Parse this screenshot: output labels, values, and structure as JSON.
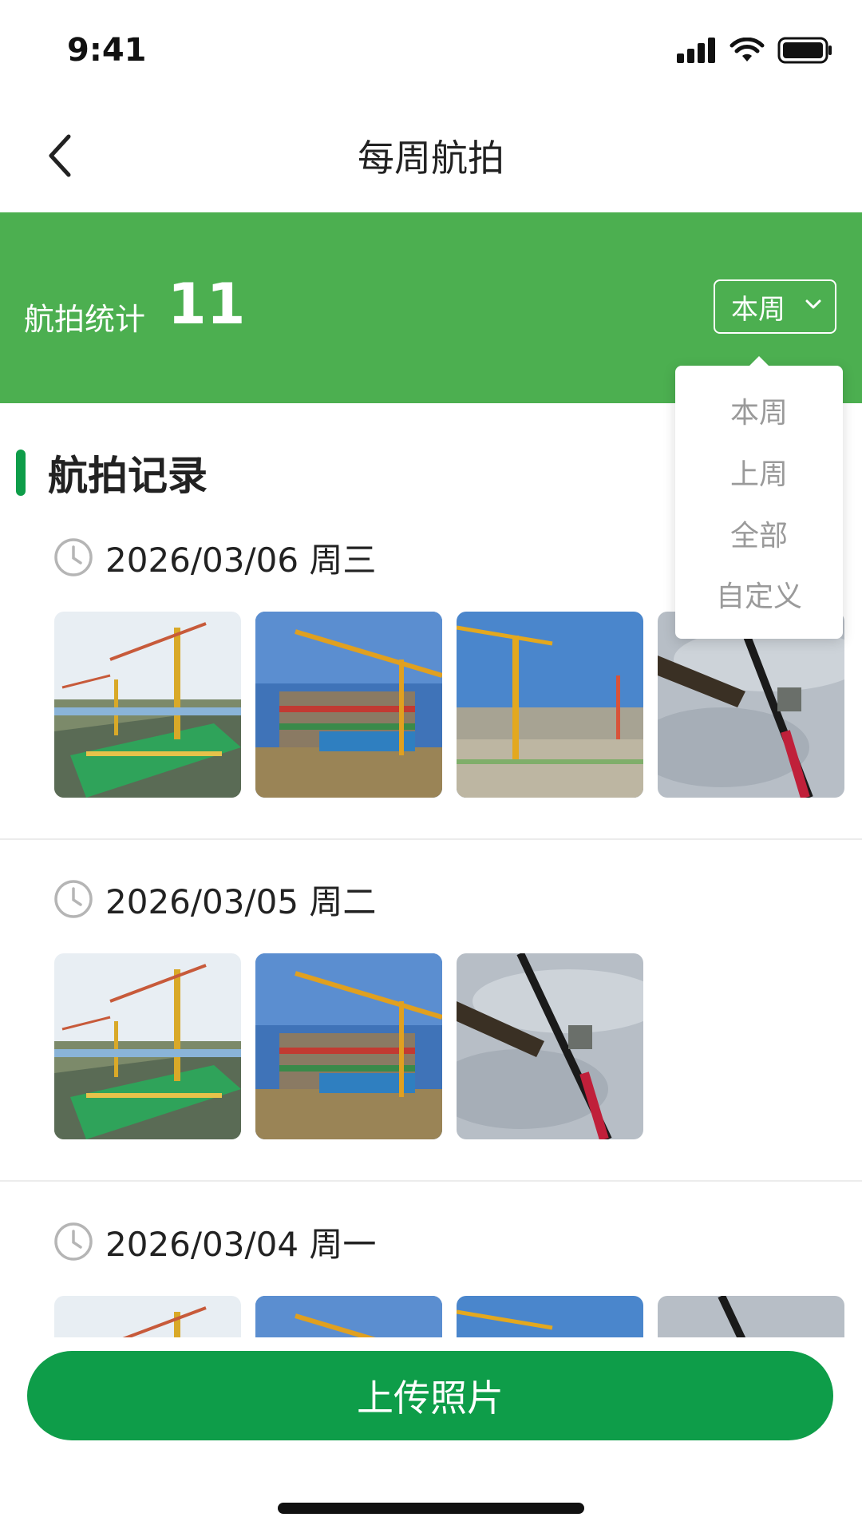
{
  "status_bar": {
    "time": "9:41"
  },
  "nav": {
    "title": "每周航拍"
  },
  "banner": {
    "label": "航拍统计",
    "count": "11",
    "period_selected": "本周"
  },
  "dropdown": {
    "options": [
      "本周",
      "上周",
      "全部",
      "自定义"
    ]
  },
  "section": {
    "title": "航拍记录"
  },
  "records": [
    {
      "date": "2026/03/06 周三",
      "photos": [
        "crane-site-photo",
        "building-frame-photo",
        "tower-crane-photo",
        "crane-jib-sky-photo"
      ]
    },
    {
      "date": "2026/03/05 周二",
      "photos": [
        "crane-site-photo",
        "building-frame-photo",
        "crane-jib-sky-photo"
      ]
    },
    {
      "date": "2026/03/04 周一",
      "photos": [
        "crane-site-photo",
        "building-frame-photo",
        "tower-crane-photo",
        "crane-jib-sky-photo"
      ]
    }
  ],
  "actions": {
    "upload_label": "上传照片"
  },
  "colors": {
    "banner_green": "#4caf50",
    "primary_green": "#0e9d49",
    "dropdown_text": "#9a9a9a"
  }
}
